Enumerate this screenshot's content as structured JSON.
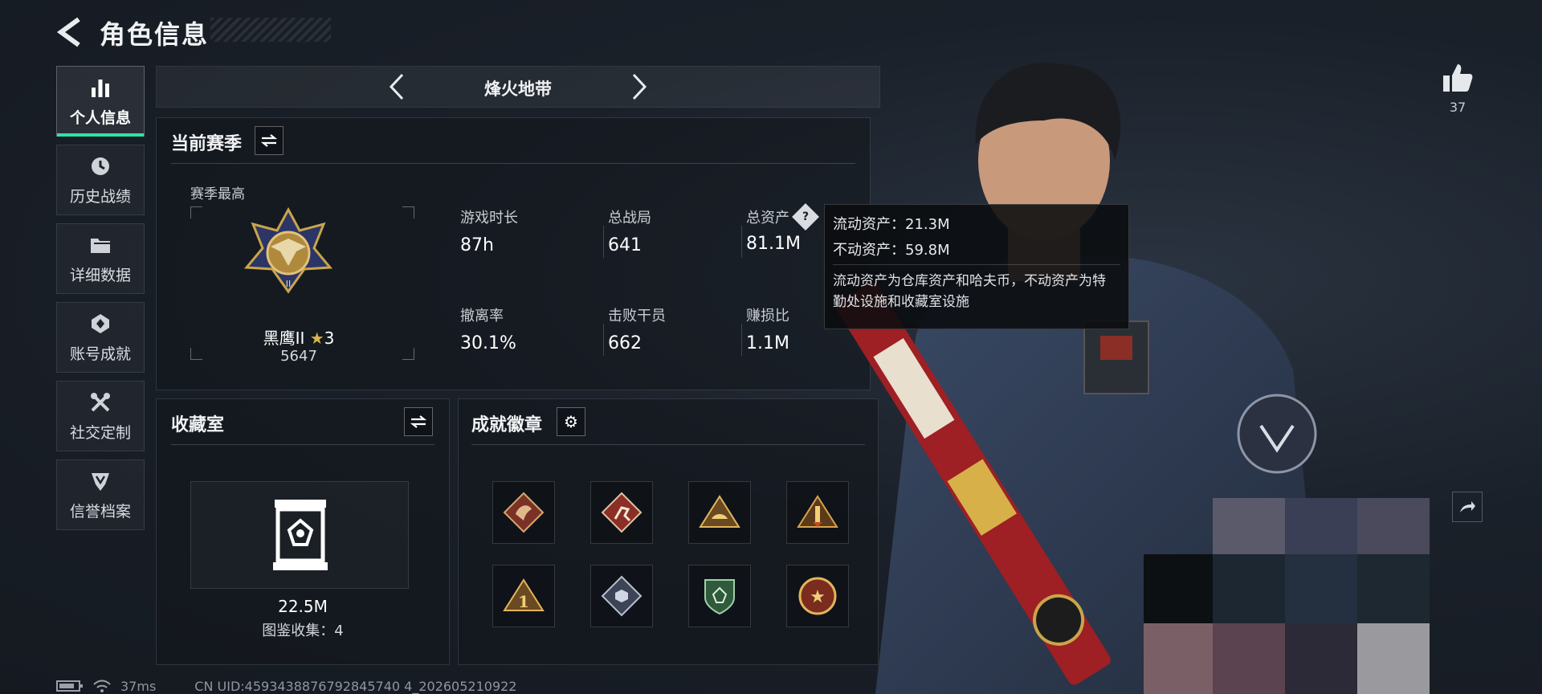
{
  "header": {
    "title": "角色信息"
  },
  "sidebar": {
    "items": [
      {
        "label": "个人信息",
        "icon": "bar-chart-icon",
        "active": true
      },
      {
        "label": "历史战绩",
        "icon": "history-icon",
        "active": false
      },
      {
        "label": "详细数据",
        "icon": "folder-icon",
        "active": false
      },
      {
        "label": "账号成就",
        "icon": "achievement-icon",
        "active": false
      },
      {
        "label": "社交定制",
        "icon": "tools-icon",
        "active": false
      },
      {
        "label": "信誉档案",
        "icon": "shield-icon",
        "active": false
      }
    ]
  },
  "mode": {
    "title": "烽火地带"
  },
  "season": {
    "title": "当前赛季",
    "best_label": "赛季最高",
    "rank_name": "黑鹰II",
    "rank_stars": "3",
    "rank_score": "5647",
    "stats": [
      {
        "label": "游戏时长",
        "value": "87h"
      },
      {
        "label": "总战局",
        "value": "641"
      },
      {
        "label": "总资产",
        "value": "81.1M"
      },
      {
        "label": "撤离率",
        "value": "30.1%"
      },
      {
        "label": "击败干员",
        "value": "662"
      },
      {
        "label": "赚损比",
        "value": "1.1M"
      }
    ]
  },
  "tooltip": {
    "liquid": "流动资产：21.3M",
    "fixed": "不动资产：59.8M",
    "desc": "流动资产为仓库资产和哈夫币，不动资产为特勤处设施和收藏室设施"
  },
  "collection": {
    "title": "收藏室",
    "value": "22.5M",
    "count_label": "图鉴收集：4"
  },
  "badges": {
    "title": "成就徽章",
    "items": [
      "dragon-badge",
      "runner-badge",
      "pyramid-badge",
      "rocket-badge",
      "number-one-badge",
      "cube-badge",
      "green-shield-badge",
      "star-emblem-badge"
    ]
  },
  "likes": {
    "count": "37"
  },
  "status": {
    "ping": "37ms",
    "uid": "CN UID:4593438876792845740 4_202605210922"
  },
  "colors": {
    "accent": "#2fe3a6",
    "gold": "#c9a54a"
  }
}
